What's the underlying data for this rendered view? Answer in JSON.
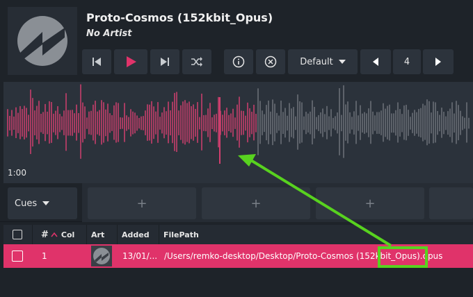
{
  "track": {
    "title": "Proto-Cosmos (152kbit_Opus)",
    "artist": "No Artist"
  },
  "transport": {
    "prev_icon": "skip-back-icon",
    "play_icon": "play-icon",
    "next_icon": "skip-forward-icon",
    "shuffle_icon": "shuffle-icon",
    "info_icon": "info-icon",
    "close_icon": "close-circle-icon",
    "preset_label": "Default",
    "counter_value": "4"
  },
  "waveform": {
    "time_label": "1:00",
    "played_color": "#d23f6f",
    "unplayed_color": "#6e737a",
    "played_fraction": 0.54
  },
  "cues": {
    "select_label": "Cues",
    "slot_icon": "+",
    "slots": [
      "+",
      "+",
      "+"
    ]
  },
  "table": {
    "columns": [
      "#",
      "Col",
      "Art",
      "Added",
      "FilePath"
    ],
    "rows": [
      {
        "number": "1",
        "added": "13/01/...",
        "filepath": "/Users/remko-desktop/Desktop/Proto-Cosmos (152kbit_Opus).opus"
      }
    ],
    "selected_color": "#e0336a"
  },
  "annotation": {
    "color": "#58d21f"
  }
}
